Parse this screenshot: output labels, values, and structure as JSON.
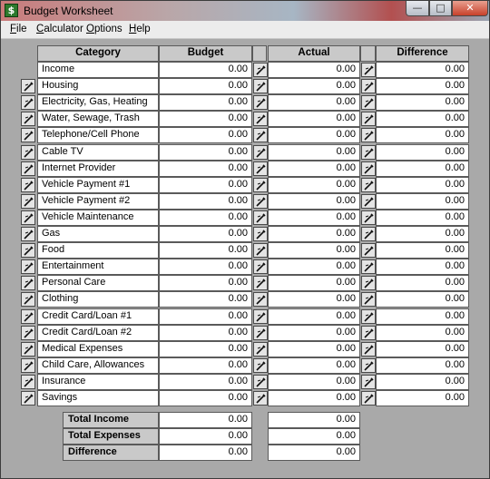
{
  "window": {
    "title": "Budget Worksheet",
    "icon": "dollar-icon",
    "controls": {
      "minimize": "—",
      "maximize": "□",
      "close": "✕"
    }
  },
  "menu": [
    {
      "id": "file",
      "label": "File"
    },
    {
      "id": "calculator",
      "label": "Calculator"
    },
    {
      "id": "options",
      "label": "Options"
    },
    {
      "id": "help",
      "label": "Help"
    }
  ],
  "headers": {
    "category": "Category",
    "budget": "Budget",
    "actual": "Actual",
    "difference": "Difference"
  },
  "row_button_icon": "pen-icon",
  "rows": [
    {
      "category": "Income",
      "budget": "0.00",
      "actual": "0.00",
      "difference": "0.00",
      "edit_button": false
    },
    {
      "category": "Housing",
      "budget": "0.00",
      "actual": "0.00",
      "difference": "0.00",
      "edit_button": true
    },
    {
      "category": "Electricity, Gas, Heating",
      "budget": "0.00",
      "actual": "0.00",
      "difference": "0.00",
      "edit_button": true
    },
    {
      "category": "Water, Sewage, Trash",
      "budget": "0.00",
      "actual": "0.00",
      "difference": "0.00",
      "edit_button": true
    },
    {
      "category": "Telephone/Cell Phone",
      "budget": "0.00",
      "actual": "0.00",
      "difference": "0.00",
      "edit_button": true
    },
    {
      "category": "Cable TV",
      "budget": "0.00",
      "actual": "0.00",
      "difference": "0.00",
      "edit_button": true
    },
    {
      "category": "Internet Provider",
      "budget": "0.00",
      "actual": "0.00",
      "difference": "0.00",
      "edit_button": true
    },
    {
      "category": "Vehicle Payment #1",
      "budget": "0.00",
      "actual": "0.00",
      "difference": "0.00",
      "edit_button": true
    },
    {
      "category": "Vehicle Payment #2",
      "budget": "0.00",
      "actual": "0.00",
      "difference": "0.00",
      "edit_button": true
    },
    {
      "category": "Vehicle Maintenance",
      "budget": "0.00",
      "actual": "0.00",
      "difference": "0.00",
      "edit_button": true
    },
    {
      "category": "Gas",
      "budget": "0.00",
      "actual": "0.00",
      "difference": "0.00",
      "edit_button": true
    },
    {
      "category": "Food",
      "budget": "0.00",
      "actual": "0.00",
      "difference": "0.00",
      "edit_button": true
    },
    {
      "category": "Entertainment",
      "budget": "0.00",
      "actual": "0.00",
      "difference": "0.00",
      "edit_button": true
    },
    {
      "category": "Personal Care",
      "budget": "0.00",
      "actual": "0.00",
      "difference": "0.00",
      "edit_button": true
    },
    {
      "category": "Clothing",
      "budget": "0.00",
      "actual": "0.00",
      "difference": "0.00",
      "edit_button": true
    },
    {
      "category": "Credit Card/Loan #1",
      "budget": "0.00",
      "actual": "0.00",
      "difference": "0.00",
      "edit_button": true
    },
    {
      "category": "Credit Card/Loan #2",
      "budget": "0.00",
      "actual": "0.00",
      "difference": "0.00",
      "edit_button": true
    },
    {
      "category": "Medical Expenses",
      "budget": "0.00",
      "actual": "0.00",
      "difference": "0.00",
      "edit_button": true
    },
    {
      "category": "Child Care, Allowances",
      "budget": "0.00",
      "actual": "0.00",
      "difference": "0.00",
      "edit_button": true
    },
    {
      "category": "Insurance",
      "budget": "0.00",
      "actual": "0.00",
      "difference": "0.00",
      "edit_button": true
    },
    {
      "category": "Savings",
      "budget": "0.00",
      "actual": "0.00",
      "difference": "0.00",
      "edit_button": true
    }
  ],
  "totals": [
    {
      "label": "Total Income",
      "budget": "0.00",
      "actual": "0.00"
    },
    {
      "label": "Total Expenses",
      "budget": "0.00",
      "actual": "0.00"
    },
    {
      "label": "Difference",
      "budget": "0.00",
      "actual": "0.00"
    }
  ]
}
